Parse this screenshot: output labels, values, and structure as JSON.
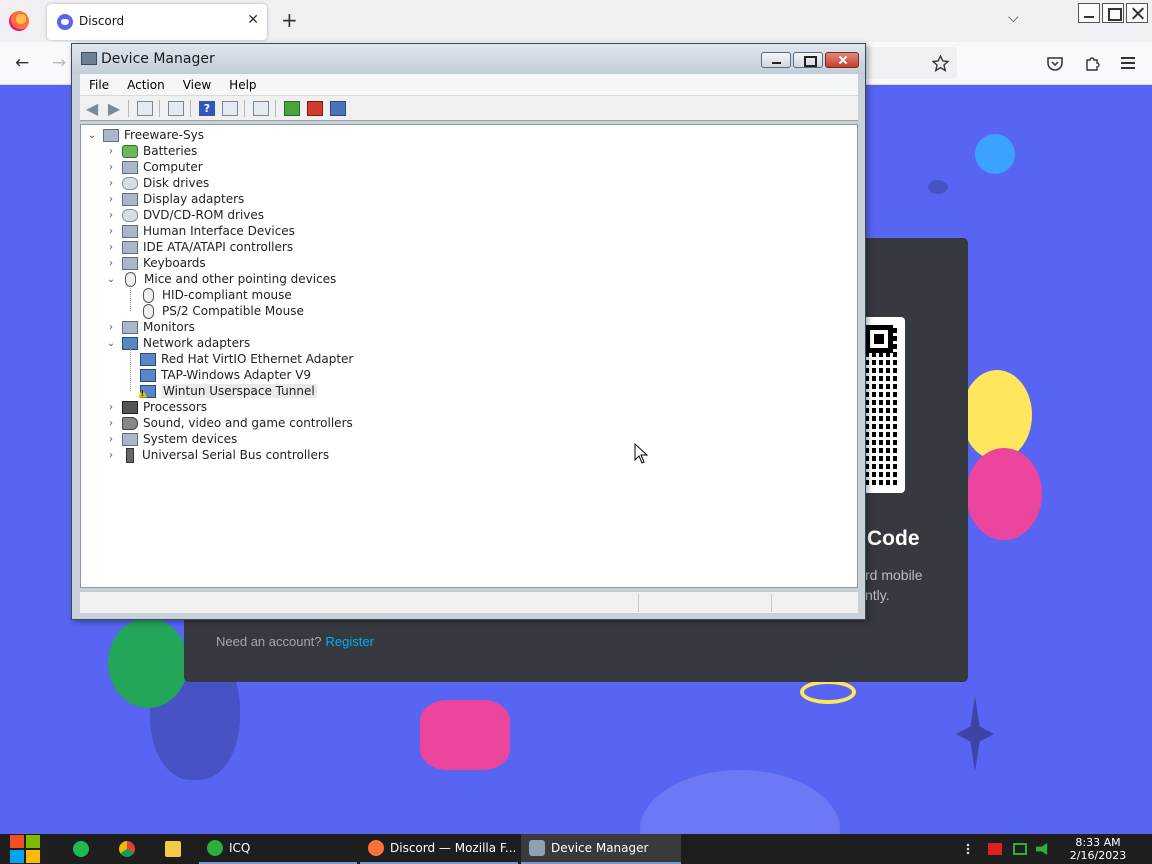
{
  "browser": {
    "tab_title": "Discord",
    "tab_close": "✕",
    "new_tab": "+",
    "tab_list": "⌵",
    "nav": {
      "back": "←",
      "forward": "→"
    }
  },
  "discord": {
    "login_code_title": "Code",
    "login_code_desc": "rd mobile\nntly.",
    "need_account": "Need an account?",
    "register": "Register"
  },
  "device_manager": {
    "title": "Device Manager",
    "menu": [
      "File",
      "Action",
      "View",
      "Help"
    ],
    "root": "Freeware-Sys",
    "tree": [
      {
        "label": "Batteries",
        "expanded": false,
        "icon": "battery-icon"
      },
      {
        "label": "Computer",
        "expanded": false,
        "icon": "computer-icon"
      },
      {
        "label": "Disk drives",
        "expanded": false,
        "icon": "disk-drive-icon"
      },
      {
        "label": "Display adapters",
        "expanded": false,
        "icon": "display-adapter-icon"
      },
      {
        "label": "DVD/CD-ROM drives",
        "expanded": false,
        "icon": "dvd-drive-icon"
      },
      {
        "label": "Human Interface Devices",
        "expanded": false,
        "icon": "hid-icon"
      },
      {
        "label": "IDE ATA/ATAPI controllers",
        "expanded": false,
        "icon": "ide-controller-icon"
      },
      {
        "label": "Keyboards",
        "expanded": false,
        "icon": "keyboard-icon"
      },
      {
        "label": "Mice and other pointing devices",
        "expanded": true,
        "icon": "mouse-icon",
        "children": [
          {
            "label": "HID-compliant mouse",
            "icon": "mouse-icon"
          },
          {
            "label": "PS/2 Compatible Mouse",
            "icon": "mouse-icon"
          }
        ]
      },
      {
        "label": "Monitors",
        "expanded": false,
        "icon": "monitor-icon"
      },
      {
        "label": "Network adapters",
        "expanded": true,
        "icon": "network-adapter-icon",
        "children": [
          {
            "label": "Red Hat VirtIO Ethernet Adapter",
            "icon": "network-adapter-icon"
          },
          {
            "label": "TAP-Windows Adapter V9",
            "icon": "network-adapter-icon"
          },
          {
            "label": "Wintun Userspace Tunnel",
            "icon": "network-adapter-warning-icon",
            "warning": true,
            "selected": true
          }
        ]
      },
      {
        "label": "Processors",
        "expanded": false,
        "icon": "processor-icon"
      },
      {
        "label": "Sound, video and game controllers",
        "expanded": false,
        "icon": "speaker-icon"
      },
      {
        "label": "System devices",
        "expanded": false,
        "icon": "system-devices-icon"
      },
      {
        "label": "Universal Serial Bus controllers",
        "expanded": false,
        "icon": "usb-icon"
      }
    ]
  },
  "taskbar": {
    "apps": [
      {
        "label": "ICQ",
        "icon": "icq-icon"
      },
      {
        "label": "Discord — Mozilla F...",
        "icon": "firefox-icon"
      },
      {
        "label": "Device Manager",
        "icon": "device-manager-icon"
      }
    ],
    "clock_time": "8:33 AM",
    "clock_date": "2/16/2023"
  },
  "colors": {
    "discord_blurple": "#5865f2",
    "discord_card": "#36393f",
    "link": "#00aff4",
    "taskbar": "#1e1e1e"
  }
}
